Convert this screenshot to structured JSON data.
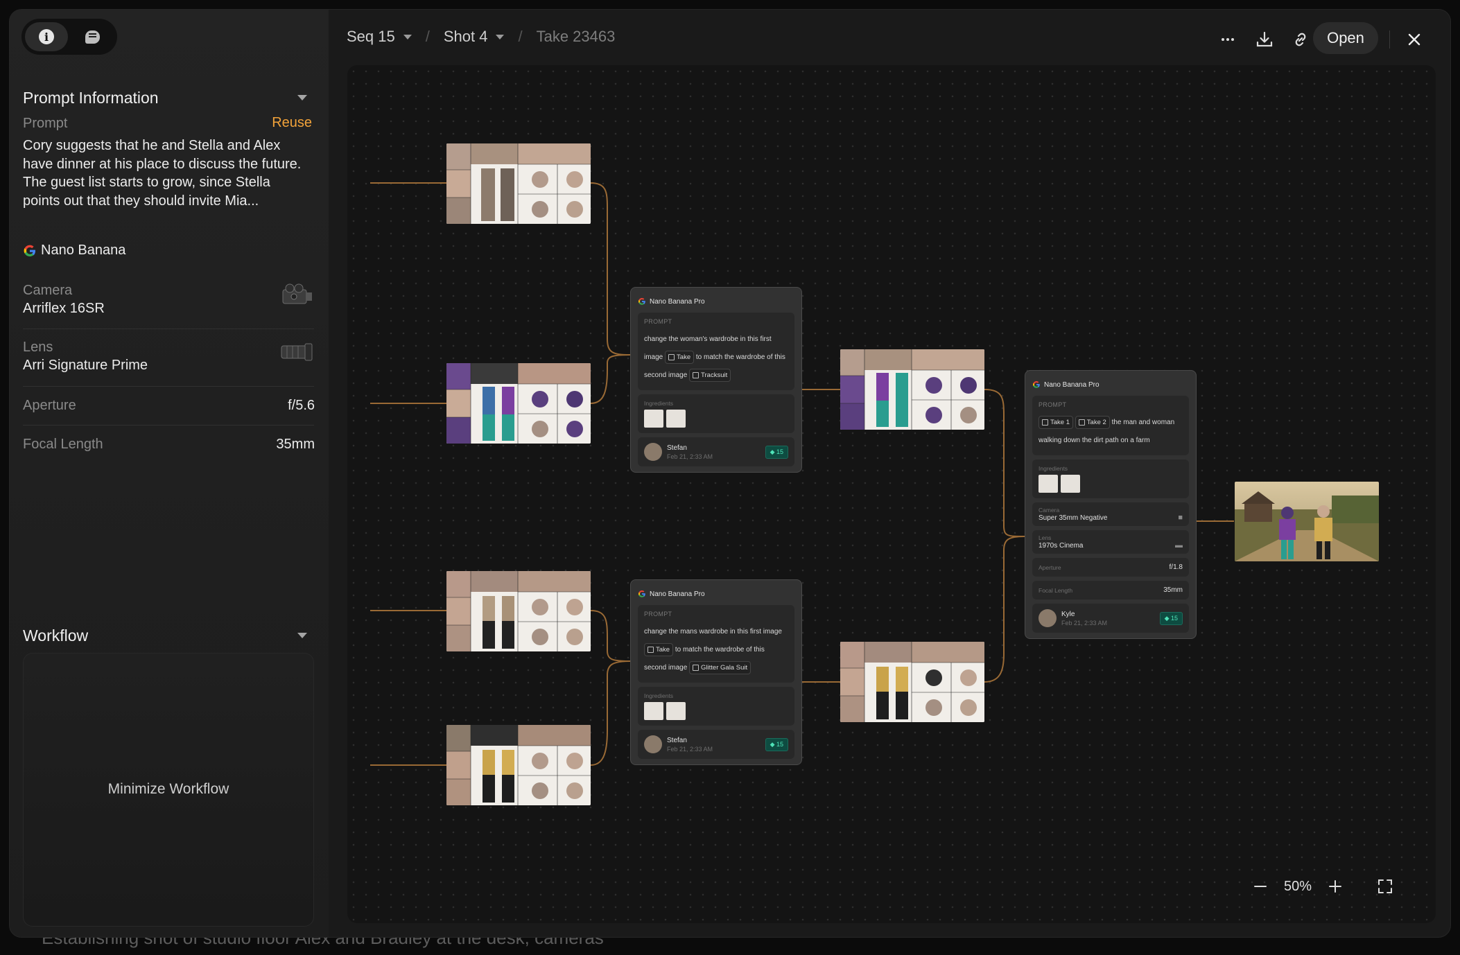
{
  "sidebar": {
    "tabs": [
      {
        "icon": "info-icon"
      },
      {
        "icon": "chat-icon"
      }
    ],
    "prompt_section": {
      "title": "Prompt Information",
      "prompt_label": "Prompt",
      "reuse_label": "Reuse",
      "prompt_text": "Cory suggests that he and Stella and Alex have dinner at his place to discuss the future. The guest list starts to grow, since Stella points out that they should invite Mia...",
      "model": "Nano Banana",
      "camera_label": "Camera",
      "camera_value": "Arriflex 16SR",
      "lens_label": "Lens",
      "lens_value": "Arri Signature Prime",
      "aperture_label": "Aperture",
      "aperture_value": "f/5.6",
      "focal_label": "Focal Length",
      "focal_value": "35mm"
    },
    "workflow_section": {
      "title": "Workflow",
      "minimize_label": "Minimize Workflow"
    }
  },
  "header": {
    "seq": "Seq 15",
    "shot": "Shot 4",
    "take": "Take 23463",
    "open_label": "Open"
  },
  "nodes": {
    "n1": {
      "model": "Nano Banana Pro",
      "prompt_title": "PROMPT",
      "p1": "change the woman's wardrobe in this first image",
      "chip1": "Take",
      "p2": "to match the wardrobe of this second image",
      "chip2": "Tracksuit",
      "ingredients": "Ingredients",
      "user": "Stefan",
      "date": "Feb 21, 2:33 AM",
      "badge": "15"
    },
    "n2": {
      "model": "Nano Banana Pro",
      "prompt_title": "PROMPT",
      "p1": "change the mans wardrobe in this first image",
      "chip1": "Take",
      "p2": "to match the wardrobe of this second image",
      "chip2": "Glitter Gala Suit",
      "ingredients": "Ingredients",
      "user": "Stefan",
      "date": "Feb 21, 2:33 AM",
      "badge": "15"
    },
    "n3": {
      "model": "Nano Banana Pro",
      "prompt_title": "PROMPT",
      "chip1": "Take 1",
      "chip2": "Take 2",
      "p1": "the man and woman walking down the dirt path on a farm",
      "ingredients": "Ingredients",
      "camera_label": "Camera",
      "camera_value": "Super 35mm Negative",
      "lens_label": "Lens",
      "lens_value": "1970s Cinema",
      "aperture_label": "Aperture",
      "aperture_value": "f/1.8",
      "focal_label": "Focal Length",
      "focal_value": "35mm",
      "user": "Kyle",
      "date": "Feb 21, 2:33 AM",
      "badge": "15"
    }
  },
  "zoom": {
    "level": "50%"
  },
  "background_text": "Establishing shot of studio floor     Alex and Bradley at the desk, cameras",
  "colors": {
    "accent": "#f2a33a",
    "wire": "#b27a3c",
    "badge": "#4fe3b8"
  }
}
